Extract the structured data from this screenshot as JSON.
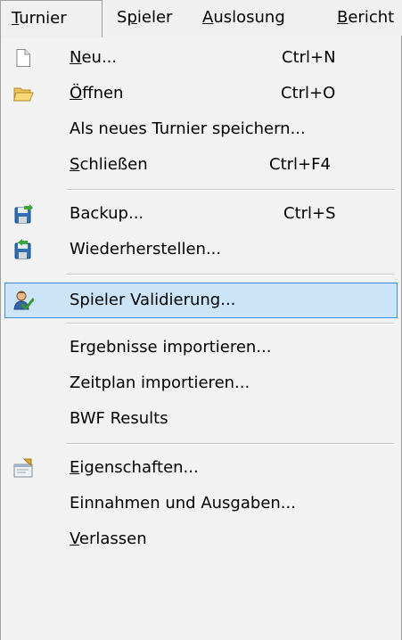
{
  "menubar": {
    "items": [
      {
        "pre": "",
        "u": "T",
        "post": "urnier"
      },
      {
        "pre": "S",
        "u": "p",
        "post": "ieler"
      },
      {
        "pre": "",
        "u": "A",
        "post": "uslosung"
      },
      {
        "pre": "",
        "u": "B",
        "post": "ericht"
      }
    ]
  },
  "menu": {
    "items": [
      {
        "pre": "",
        "u": "N",
        "post": "eu...",
        "shortcut": "Ctrl+N",
        "icon": "new-document-icon"
      },
      {
        "pre": "",
        "u": "Ö",
        "post": "ffnen",
        "shortcut": "Ctrl+O",
        "icon": "open-folder-icon"
      },
      {
        "pre": "Als neues Turnier speichern...",
        "u": "",
        "post": "",
        "shortcut": ""
      },
      {
        "pre": "",
        "u": "S",
        "post": "chließen",
        "shortcut": "Ctrl+F4"
      },
      {
        "pre": "Backup...",
        "u": "",
        "post": "",
        "shortcut": "Ctrl+S",
        "icon": "backup-save-icon"
      },
      {
        "pre": "Wiederherstellen...",
        "u": "",
        "post": "",
        "shortcut": "",
        "icon": "restore-icon"
      },
      {
        "pre": "Spieler Validierung...",
        "u": "",
        "post": "",
        "shortcut": "",
        "icon": "player-validation-icon",
        "highlighted": true
      },
      {
        "pre": "Ergebnisse importieren...",
        "u": "",
        "post": "",
        "shortcut": ""
      },
      {
        "pre": "Zeitplan importieren...",
        "u": "",
        "post": "",
        "shortcut": ""
      },
      {
        "pre": "BWF Results",
        "u": "",
        "post": "",
        "shortcut": ""
      },
      {
        "pre": "",
        "u": "E",
        "post": "igenschaften...",
        "shortcut": "",
        "icon": "properties-icon"
      },
      {
        "pre": "Einnahmen und Ausgaben...",
        "u": "",
        "post": "",
        "shortcut": ""
      },
      {
        "pre": "",
        "u": "V",
        "post": "erlassen",
        "shortcut": ""
      }
    ]
  },
  "colors": {
    "highlight_fill": "#cce4f7",
    "highlight_border": "#3d8ee0",
    "menu_background": "#f2f2f2"
  }
}
